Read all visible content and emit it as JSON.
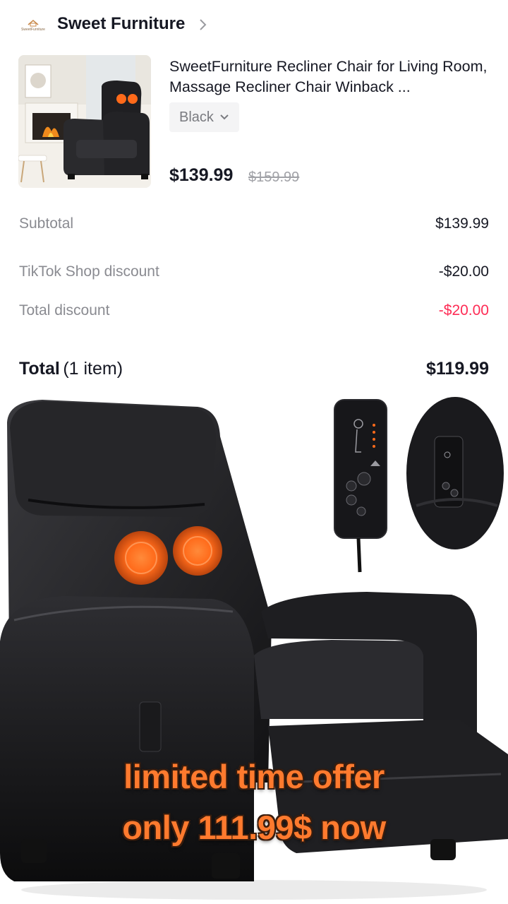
{
  "store": {
    "name": "Sweet Furniture",
    "logo_text": "SweetFurniture",
    "chevron_icon": "chevron-right-icon"
  },
  "product": {
    "title": "SweetFurniture Recliner Chair for Living Room, Massage Recliner Chair Winback ...",
    "variant": "Black",
    "price": "$139.99",
    "original_price": "$159.99"
  },
  "summary": {
    "subtotal_label": "Subtotal",
    "subtotal_value": "$139.99",
    "shop_discount_label": "TikTok Shop discount",
    "shop_discount_value": "-$20.00",
    "total_discount_label": "Total discount",
    "total_discount_value": "-$20.00",
    "total_label": "Total",
    "total_count": "(1 item)",
    "total_value": "$119.99"
  },
  "overlay": {
    "line1": "limited time offer",
    "line2": "only 111.99$ now"
  },
  "colors": {
    "discount": "#fe2c55",
    "caption": "#ff7a2e"
  }
}
